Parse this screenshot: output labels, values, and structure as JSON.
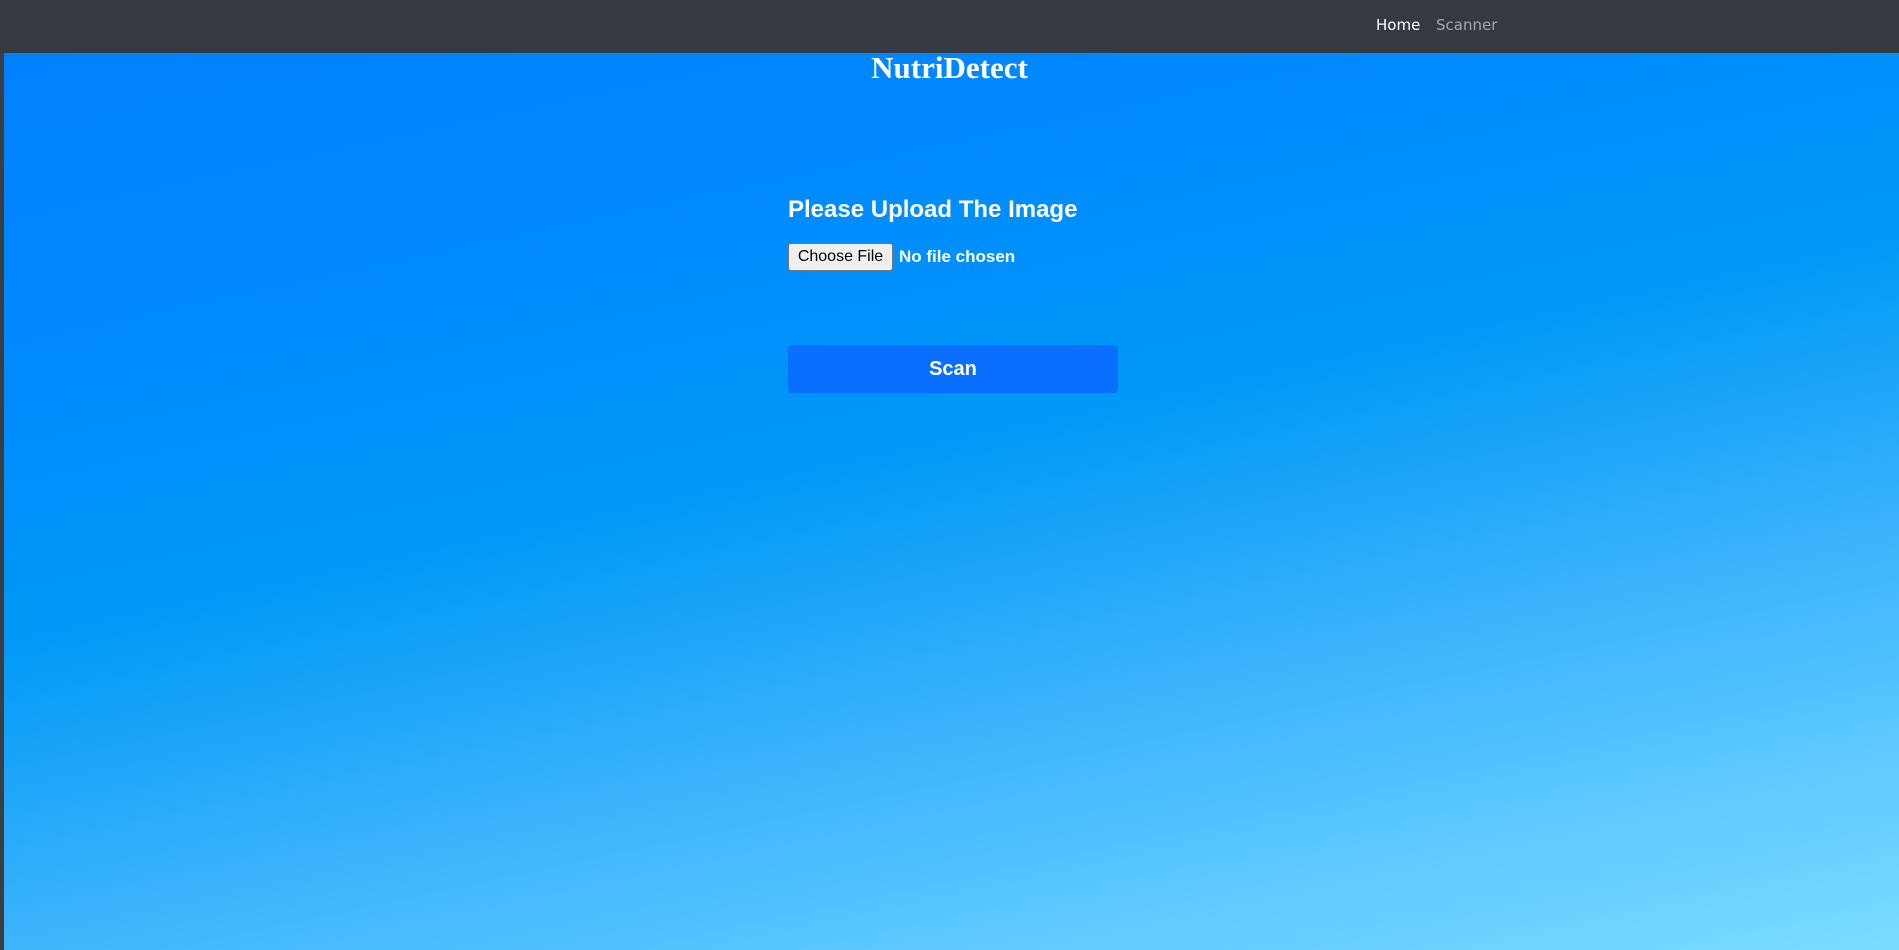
{
  "nav": {
    "items": [
      {
        "label": "Home",
        "active": true
      },
      {
        "label": "Scanner",
        "active": false
      }
    ]
  },
  "hero": {
    "brand": "NutriDetect",
    "upload_heading": "Please Upload The Image",
    "file_input": {
      "button_label": "Choose File",
      "status": "No file chosen"
    },
    "scan_button_label": "Scan"
  },
  "colors": {
    "navbar_bg": "#343a40",
    "gradient_top": "#0080ff",
    "gradient_bottom": "#7adcff",
    "scan_button_bg": "#0a6eff",
    "text": "#ffffff"
  }
}
